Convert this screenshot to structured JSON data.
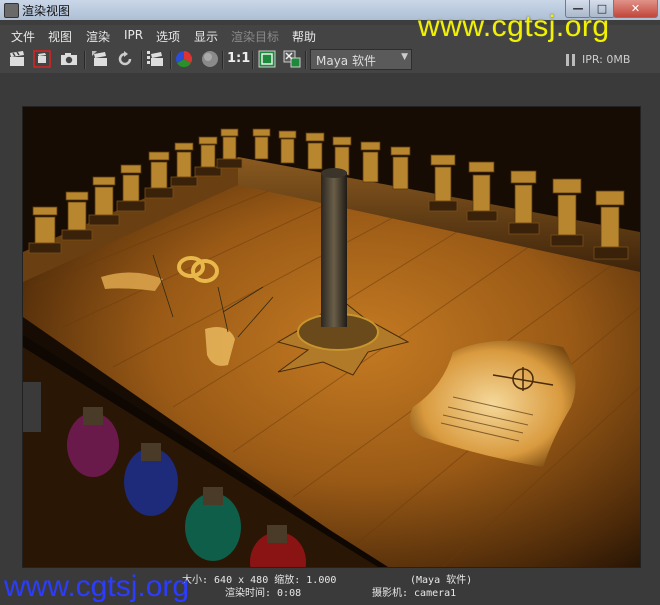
{
  "window": {
    "title": "渲染视图"
  },
  "watermark": {
    "top": "www.cgtsj.org",
    "bottom": "www.cgtsj.org"
  },
  "menu": [
    {
      "label": "文件",
      "enabled": true
    },
    {
      "label": "视图",
      "enabled": true
    },
    {
      "label": "渲染",
      "enabled": true
    },
    {
      "label": "IPR",
      "enabled": true
    },
    {
      "label": "选项",
      "enabled": true
    },
    {
      "label": "显示",
      "enabled": true
    },
    {
      "label": "渲染目标",
      "enabled": false
    },
    {
      "label": "帮助",
      "enabled": true
    }
  ],
  "toolbar": {
    "icons": [
      "render-clapper-icon",
      "region-render-icon",
      "snapshot-icon",
      "ipr-render-icon",
      "refresh-icon",
      "render-sequence-icon",
      "rgb-channel-icon",
      "alpha-channel-icon",
      "one-to-one-icon",
      "keep-image-icon",
      "remove-image-icon"
    ],
    "one_to_one_label": "1:1",
    "renderer": "Maya 软件",
    "ipr_status": "IPR: 0MB"
  },
  "render_info": {
    "size": "大小: 640 x 480 缩放: 1.000",
    "renderer": "(Maya 软件)",
    "time": "渲染时间: 0:08",
    "camera": "摄影机: camera1"
  },
  "colors": {
    "panel": "#444444",
    "titlebar": "#b8c8dc",
    "watermark_top": "#f2f200",
    "watermark_bottom": "#2c3cff"
  }
}
